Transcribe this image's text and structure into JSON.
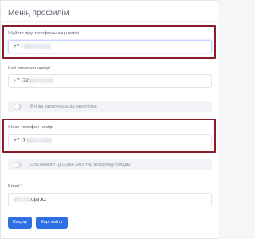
{
  "page": {
    "title": "Менің профилім"
  },
  "fields": {
    "login_phone": {
      "label": "Жүйеге кіру телефонының нөмірі",
      "value": "+7 ("
    },
    "internal_phone": {
      "label": "Ішкі телефон нөмірі",
      "value": "+7 (72"
    },
    "show_on_card": {
      "label": "Өтініш карточкасында көрсетілед"
    },
    "mobile_phone": {
      "label": "Жеке телефон нөмірі",
      "value": "+7 (7"
    },
    "sms_toggle": {
      "label": "Осы нөмірге ЦКО-дан SMS-тер жіберіледі болады"
    },
    "email": {
      "label": "Email *",
      "value": "ujar.kz"
    }
  },
  "actions": {
    "save_label": "Сақтау",
    "back_label": "Кері қайту"
  },
  "colors": {
    "highlight": "#8b1d2b",
    "primary": "#2f6fe4"
  }
}
